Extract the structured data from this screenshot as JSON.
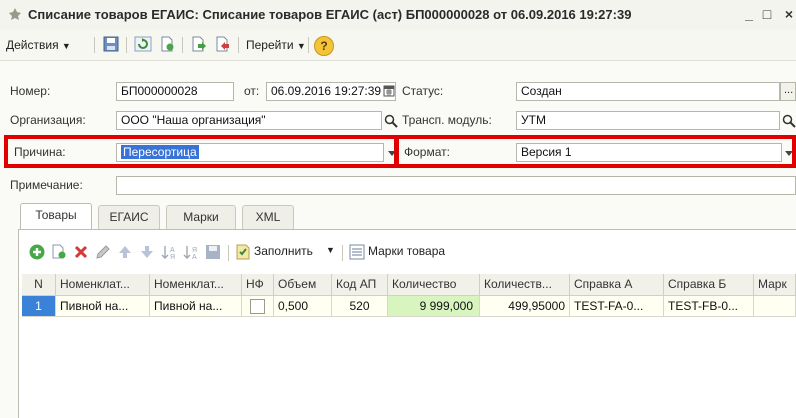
{
  "window": {
    "title": "Списание товаров ЕГАИС: Списание товаров ЕГАИС (аст) БП000000028 от 06.09.2016 19:27:39",
    "minimize": "_",
    "maximize": "□",
    "close": "×"
  },
  "toolbar": {
    "actions_label": "Действия",
    "goto_label": "Перейти",
    "help_label": "?"
  },
  "form": {
    "number_label": "Номер:",
    "number_value": "БП000000028",
    "date_label": "от:",
    "date_value": "06.09.2016 19:27:39",
    "status_label": "Статус:",
    "status_value": "Создан",
    "org_label": "Организация:",
    "org_value": "ООО \"Наша организация\"",
    "transport_label": "Трансп. модуль:",
    "transport_value": "УТМ",
    "reason_label": "Причина:",
    "reason_value": "Пересортица",
    "format_label": "Формат:",
    "format_value": "Версия 1",
    "note_label": "Примечание:",
    "note_value": ""
  },
  "tabs": [
    {
      "label": "Товары",
      "active": true
    },
    {
      "label": "ЕГАИС",
      "active": false
    },
    {
      "label": "Марки",
      "active": false
    },
    {
      "label": "XML",
      "active": false
    }
  ],
  "grid_toolbar": {
    "fill_label": "Заполнить",
    "marks_label": "Марки товара"
  },
  "table": {
    "columns": [
      "N",
      "Номенклат...",
      "Номенклат...",
      "НФ",
      "Объем",
      "Код АП",
      "Количество",
      "Количеств...",
      "Справка А",
      "Справка Б",
      "Марк"
    ],
    "rows": [
      [
        "1",
        "Пивной на...",
        "Пивной на...",
        "",
        "0,500",
        "520",
        "9 999,000",
        "499,95000",
        "TEST-FA-0...",
        "TEST-FB-0...",
        ""
      ]
    ]
  },
  "colors": {
    "highlight_border": "#e00000",
    "selection": "#3874d8",
    "quantity_cell": "#d8f5c0"
  }
}
